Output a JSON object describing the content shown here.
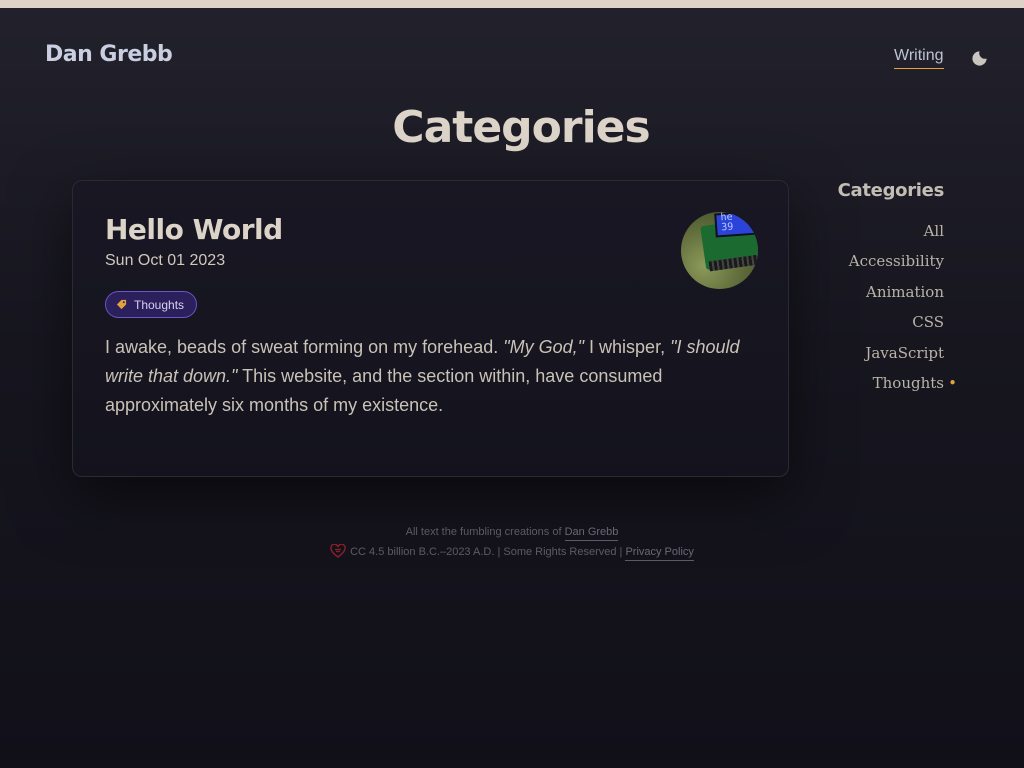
{
  "header": {
    "site_title": "Dan Grebb",
    "nav": {
      "writing_label": "Writing"
    },
    "theme_toggle_icon": "moon-icon"
  },
  "page": {
    "heading": "Categories"
  },
  "post": {
    "title": "Hello World",
    "date": "Sun Oct 01 2023",
    "thumbnail_lcd_text": "he\n39",
    "tag": {
      "label": "Thoughts",
      "icon": "tag-icon"
    },
    "excerpt": {
      "part1": "I awake, beads of sweat forming on my forehead. ",
      "quote1": "\"My God,\"",
      "part2": " I whisper, ",
      "quote2": "\"I should write that down.\"",
      "part3": " This website, and the section within, have consumed approximately six months of my existence."
    }
  },
  "sidebar": {
    "heading": "Categories",
    "items": [
      {
        "label": "All",
        "active": false
      },
      {
        "label": "Accessibility",
        "active": false
      },
      {
        "label": "Animation",
        "active": false
      },
      {
        "label": "CSS",
        "active": false
      },
      {
        "label": "JavaScript",
        "active": false
      },
      {
        "label": "Thoughts",
        "active": true
      }
    ]
  },
  "footer": {
    "line1_prefix": "All text the fumbling creations of ",
    "author_link": "Dan Grebb",
    "license_text": "CC 4.5 billion B.C.–2023 A.D. | Some Rights Reserved | ",
    "privacy_link": "Privacy Policy",
    "heart_icon": "heart-shield-icon"
  },
  "colors": {
    "accent": "#e2a23f",
    "tag_bg": "#2b1f5c",
    "tag_border": "#6b55c8",
    "background": "#17161f"
  }
}
